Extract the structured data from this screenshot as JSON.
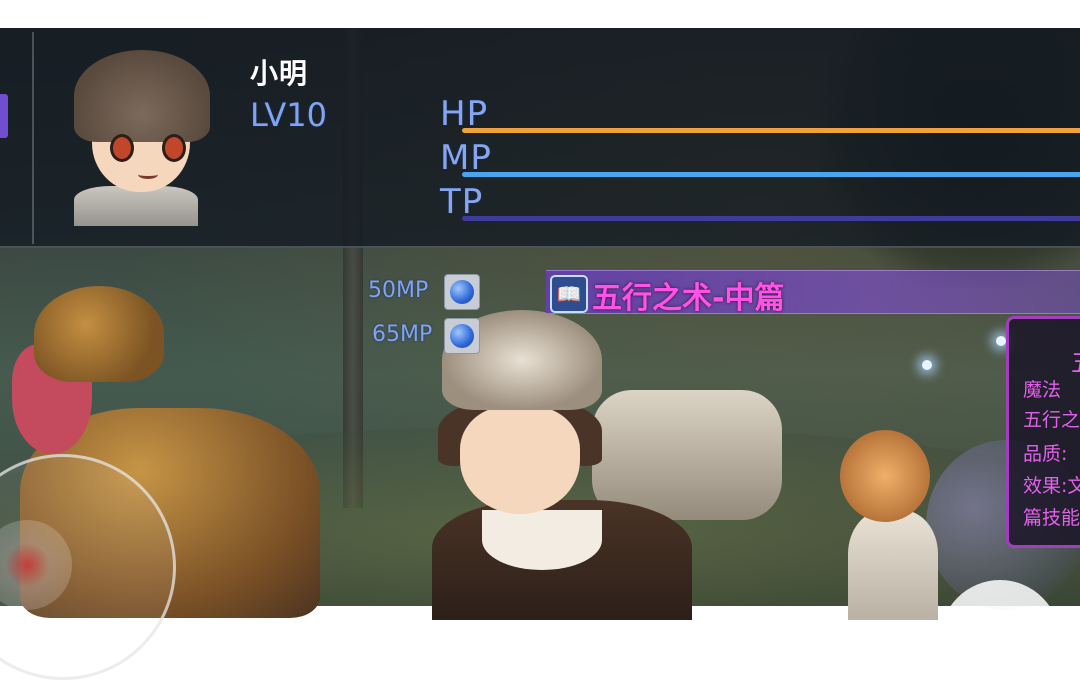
{
  "character": {
    "name": "小明",
    "level": "LV10"
  },
  "stats": [
    {
      "label": "HP",
      "fill": 1.0,
      "color": "#f2a23a"
    },
    {
      "label": "MP",
      "fill": 1.0,
      "color": "#4aa5ef"
    },
    {
      "label": "TP",
      "fill": 1.0,
      "color": "#3f3a9e"
    }
  ],
  "skill_list": [
    {
      "cost": "50MP",
      "icon": "blue-orb-icon"
    },
    {
      "cost": "65MP",
      "icon": "blue-orb-icon"
    }
  ],
  "selected_skill": {
    "icon": "spellbook-icon",
    "title": "五行之术-中篇"
  },
  "skill_detail": {
    "heading": "五",
    "type": "魔法",
    "name_partial": "五行之",
    "quality_label": "品质:",
    "effect_label": "效果:",
    "effect_partial": "效果:文",
    "line_partial": "篇技能"
  },
  "colors": {
    "accent_purple": "#a23fc0",
    "skill_text": "#ff52e6",
    "stat_label": "#86a6ef"
  }
}
